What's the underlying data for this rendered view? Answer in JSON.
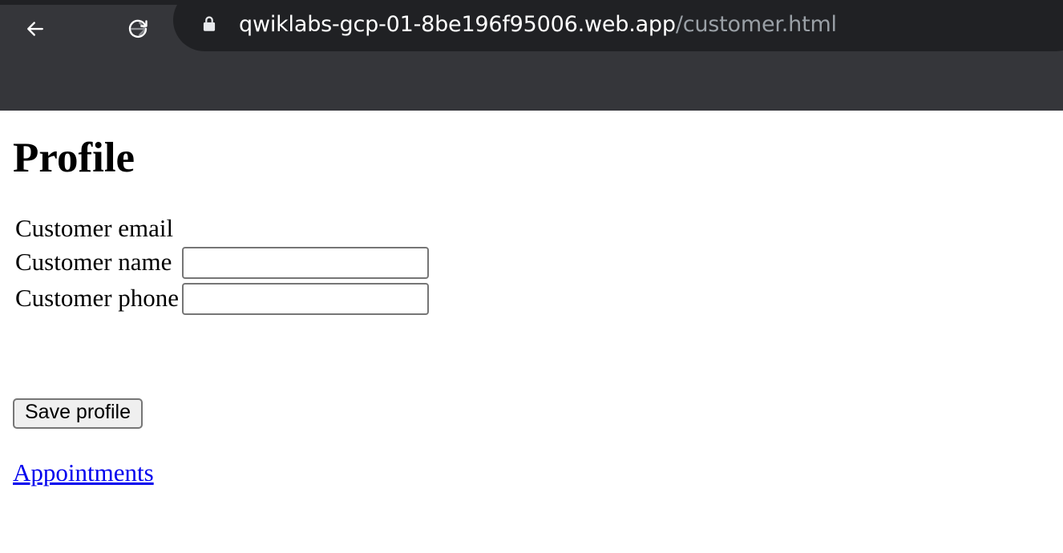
{
  "browser": {
    "nav": {
      "back_icon": "arrow-left-icon",
      "forward_icon": "arrow-right-icon",
      "reload_icon": "reload-icon"
    },
    "omnibox": {
      "security_icon": "lock-icon",
      "url_domain": "qwiklabs-gcp-01-8be196f95006.web.app",
      "url_path": "/customer.html",
      "full_url": "qwiklabs-gcp-01-8be196f95006.web.app/customer.html"
    },
    "colors": {
      "toolbar_bg": "#35363a",
      "omnibox_bg": "#202124",
      "url_domain_color": "#ffffff",
      "url_path_color": "#9aa0a6"
    }
  },
  "page": {
    "title": "Profile",
    "form": {
      "rows": [
        {
          "label": "Customer email",
          "has_input": false,
          "value": "",
          "placeholder": ""
        },
        {
          "label": "Customer name",
          "has_input": true,
          "value": "",
          "placeholder": ""
        },
        {
          "label": "Customer phone",
          "has_input": true,
          "value": "",
          "placeholder": ""
        }
      ]
    },
    "save_button_label": "Save profile",
    "appointments_link_label": "Appointments",
    "colors": {
      "background": "#ffffff",
      "text": "#000000",
      "link": "#0000ee",
      "input_border": "#767676",
      "button_bg": "#efefef"
    }
  }
}
